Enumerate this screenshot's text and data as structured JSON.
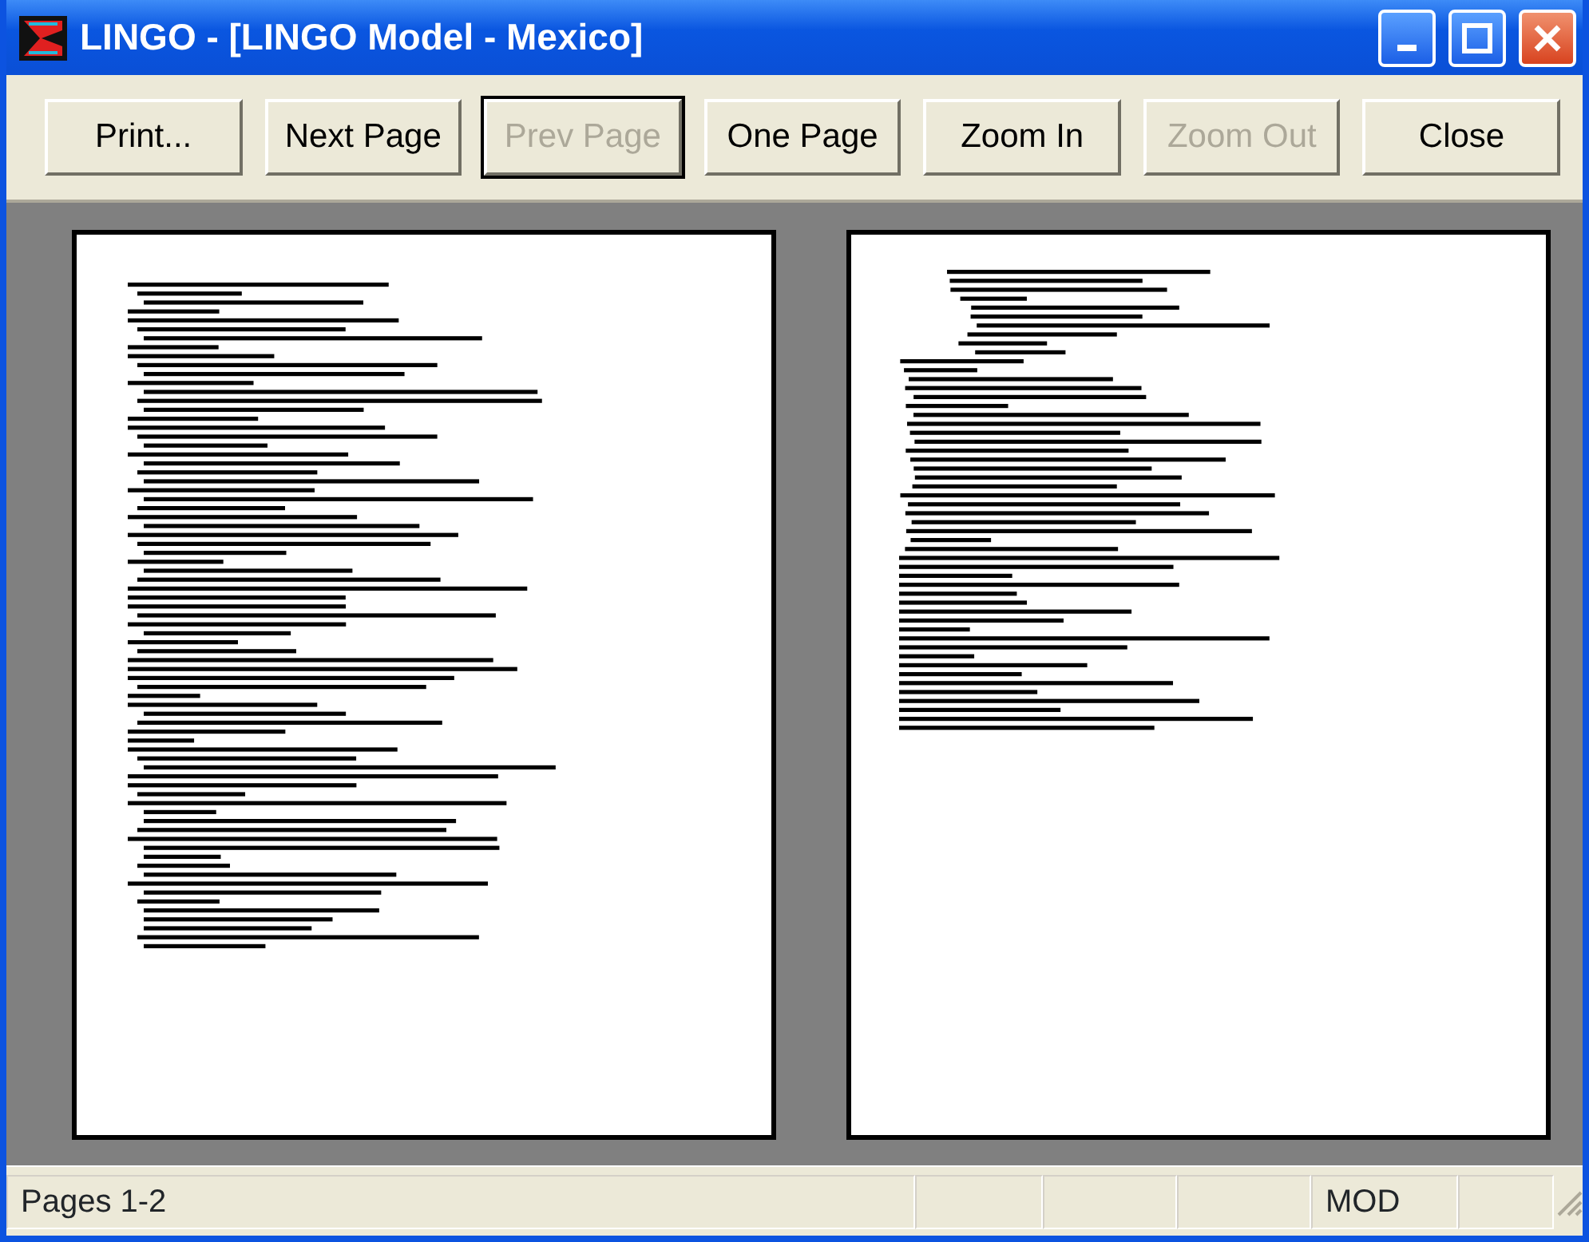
{
  "window": {
    "title": "LINGO - [LINGO Model - Mexico]"
  },
  "toolbar": [
    {
      "label": "Print...",
      "disabled": false,
      "selected": false
    },
    {
      "label": "Next Page",
      "disabled": false,
      "selected": false
    },
    {
      "label": "Prev Page",
      "disabled": true,
      "selected": true
    },
    {
      "label": "One Page",
      "disabled": false,
      "selected": false
    },
    {
      "label": "Zoom In",
      "disabled": false,
      "selected": false
    },
    {
      "label": "Zoom Out",
      "disabled": true,
      "selected": false
    },
    {
      "label": "Close",
      "disabled": false,
      "selected": false
    }
  ],
  "pages": [
    {
      "kind": "page"
    },
    {
      "kind": "page"
    }
  ],
  "status_bar": {
    "message": "Pages 1-2",
    "indicator": "MOD"
  }
}
